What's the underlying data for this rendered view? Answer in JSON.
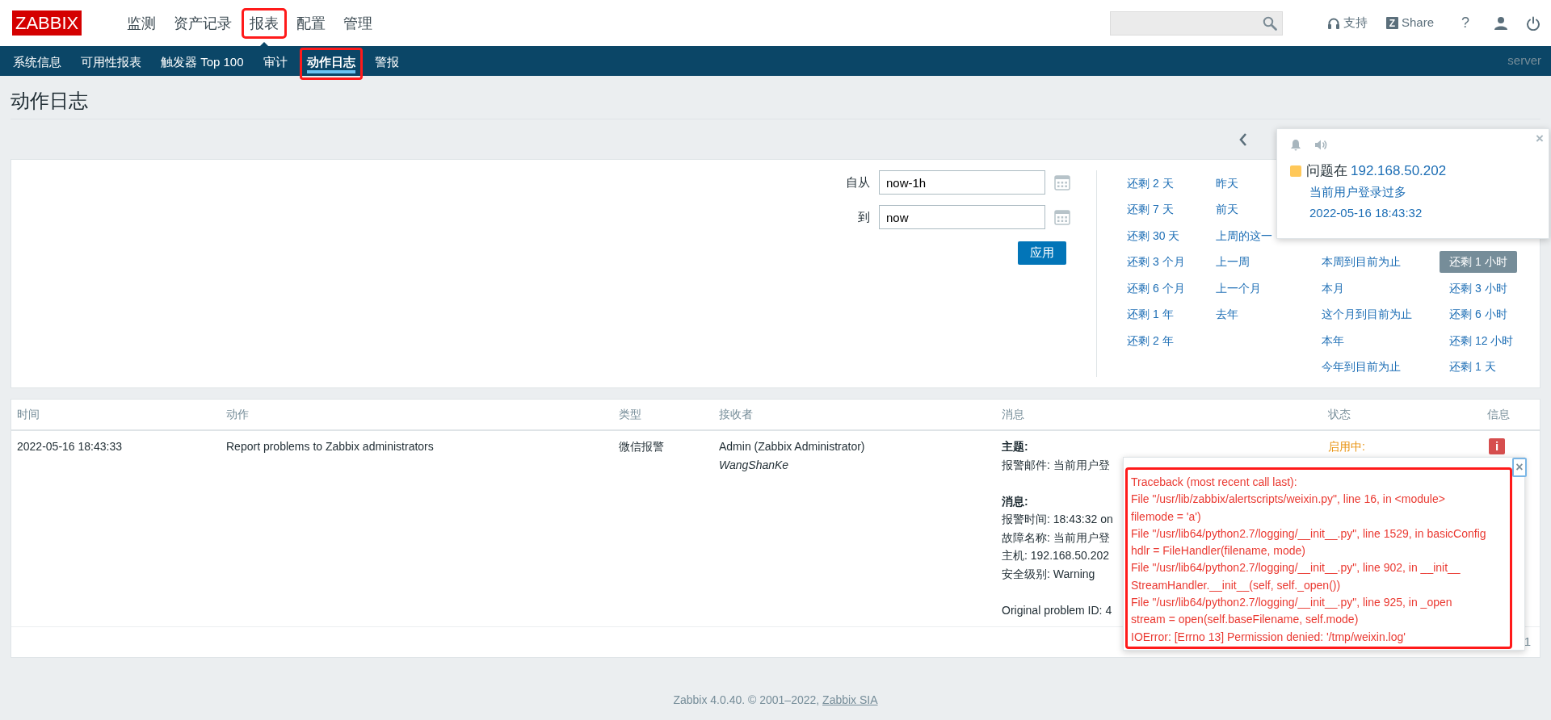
{
  "header": {
    "logo": "ZABBIX",
    "menu": [
      {
        "label": "监测",
        "selected": false,
        "annotated": false
      },
      {
        "label": "资产记录",
        "selected": false,
        "annotated": false
      },
      {
        "label": "报表",
        "selected": true,
        "annotated": true
      },
      {
        "label": "配置",
        "selected": false,
        "annotated": false
      },
      {
        "label": "管理",
        "selected": false,
        "annotated": false
      }
    ],
    "tools": [
      {
        "kind": "support",
        "label": "支持"
      },
      {
        "kind": "share",
        "icon_text": "Z",
        "label": "Share"
      },
      {
        "kind": "help",
        "label": "?"
      },
      {
        "kind": "user"
      },
      {
        "kind": "logout"
      }
    ]
  },
  "submenu": {
    "items": [
      {
        "label": "系统信息",
        "selected": false,
        "annotated": false
      },
      {
        "label": "可用性报表",
        "selected": false,
        "annotated": false
      },
      {
        "label": "触发器 Top 100",
        "selected": false,
        "annotated": false
      },
      {
        "label": "审计",
        "selected": false,
        "annotated": false
      },
      {
        "label": "动作日志",
        "selected": true,
        "annotated": true
      },
      {
        "label": "警报",
        "selected": false,
        "annotated": false
      }
    ],
    "server": "server"
  },
  "page_title": "动作日志",
  "filter": {
    "from_label": "自从",
    "from_value": "now-1h",
    "to_label": "到",
    "to_value": "now",
    "apply": "应用",
    "quick_ranges": [
      {
        "items": [
          {
            "label": "还剩 2 天",
            "selected": false
          },
          {
            "label": "还剩 7 天",
            "selected": false
          },
          {
            "label": "还剩 30 天",
            "selected": false
          },
          {
            "label": "还剩 3 个月",
            "selected": false
          },
          {
            "label": "还剩 6 个月",
            "selected": false
          },
          {
            "label": "还剩 1 年",
            "selected": false
          },
          {
            "label": "还剩 2 年",
            "selected": false
          }
        ]
      },
      {
        "items": [
          {
            "label": "昨天",
            "selected": false
          },
          {
            "label": "前天",
            "selected": false
          },
          {
            "label": "上周的这一",
            "selected": false
          },
          {
            "label": "上一周",
            "selected": false
          },
          {
            "label": "上一个月",
            "selected": false
          },
          {
            "label": "去年",
            "selected": false
          }
        ]
      },
      {
        "items": [
          {
            "label": "本周到目前为止",
            "selected": false
          },
          {
            "label": "本月",
            "selected": false
          },
          {
            "label": "这个月到目前为止",
            "selected": false
          },
          {
            "label": "本年",
            "selected": false
          },
          {
            "label": "今年到目前为止",
            "selected": false
          }
        ]
      },
      {
        "items": [
          {
            "label": "还剩 1 小时",
            "selected": true
          },
          {
            "label": "还剩 3 小时",
            "selected": false
          },
          {
            "label": "还剩 6 小时",
            "selected": false
          },
          {
            "label": "还剩 12 小时",
            "selected": false
          },
          {
            "label": "还剩 1 天",
            "selected": false
          }
        ]
      }
    ]
  },
  "table": {
    "columns": [
      "时间",
      "动作",
      "类型",
      "接收者",
      "消息",
      "状态",
      "信息"
    ],
    "rows": [
      {
        "time": "2022-05-16 18:43:33",
        "action": "Report problems to Zabbix administrators",
        "type": "微信报警",
        "recipient": "Admin (Zabbix Administrator)",
        "recipient_user": "WangShanKe",
        "message": [
          {
            "heading": "主题:",
            "lines": [
              "报警邮件: 当前用户登"
            ]
          },
          {
            "heading": "消息:",
            "lines": [
              "报警时间: 18:43:32 on",
              "故障名称: 当前用户登",
              "主机: 192.168.50.202",
              "安全级别: Warning"
            ]
          },
          {
            "lines": [
              "Original problem ID: 4"
            ]
          }
        ],
        "status": "启用中:",
        "info": "i"
      }
    ],
    "paging": "1"
  },
  "notification": {
    "title": "问题在",
    "host": "192.168.50.202",
    "problem": "当前用户登录过多",
    "time": "2022-05-16 18:43:32",
    "close": "×"
  },
  "traceback": {
    "annotated": true,
    "close": "×",
    "lines": [
      "Traceback (most recent call last):",
      "File \"/usr/lib/zabbix/alertscripts/weixin.py\", line 16, in <module>",
      "filemode = 'a')",
      "File \"/usr/lib64/python2.7/logging/__init__.py\", line 1529, in basicConfig",
      "hdlr = FileHandler(filename, mode)",
      "File \"/usr/lib64/python2.7/logging/__init__.py\", line 902, in __init__",
      "StreamHandler.__init__(self, self._open())",
      "File \"/usr/lib64/python2.7/logging/__init__.py\", line 925, in _open",
      "stream = open(self.baseFilename, self.mode)",
      "IOError: [Errno 13] Permission denied: '/tmp/weixin.log'"
    ]
  },
  "footer": {
    "text": "Zabbix 4.0.40. © 2001–2022, ",
    "link": "Zabbix SIA"
  }
}
